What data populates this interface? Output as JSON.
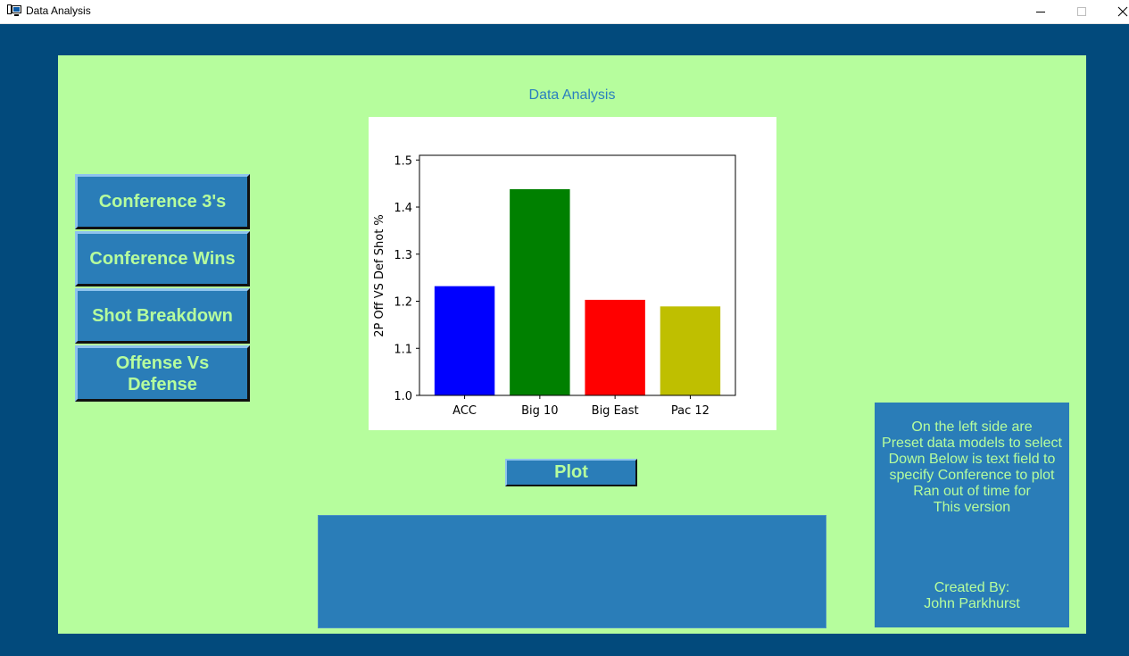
{
  "window": {
    "title": "Data Analysis",
    "icons": {
      "app": "monitor-icon",
      "minimize": "minimize-icon",
      "maximize": "maximize-icon",
      "close": "close-icon"
    }
  },
  "colors": {
    "frame": "#024a7c",
    "panel": "#b6fd9d",
    "button": "#2a7db8",
    "button_text": "#b6fd9d",
    "heading": "#2a7fbf"
  },
  "main": {
    "heading": "Data Analysis"
  },
  "sidebar": {
    "buttons": [
      {
        "label": "Conference 3's"
      },
      {
        "label": "Conference Wins"
      },
      {
        "label": "Shot Breakdown"
      },
      {
        "label": "Offense Vs Defense"
      }
    ]
  },
  "plot_button": {
    "label": "Plot"
  },
  "conference_input": {
    "value": ""
  },
  "info": {
    "lines": [
      "On the left side are",
      "Preset data models to select",
      "Down Below is text field to",
      "specify Conference to plot",
      "Ran out of time for",
      "This version"
    ],
    "credit_lines": [
      "Created By:",
      "John Parkhurst"
    ]
  },
  "chart_data": {
    "type": "bar",
    "categories": [
      "ACC",
      "Big 10",
      "Big East",
      "Pac 12"
    ],
    "values": [
      1.232,
      1.438,
      1.203,
      1.189
    ],
    "colors": [
      "#0000ff",
      "#008000",
      "#ff0000",
      "#bfbf00"
    ],
    "ylabel": "2P Off VS Def Shot %",
    "ylim": [
      1.0,
      1.51
    ],
    "yticks": [
      "1.0",
      "1.1",
      "1.2",
      "1.3",
      "1.4",
      "1.5"
    ],
    "grid": false
  }
}
